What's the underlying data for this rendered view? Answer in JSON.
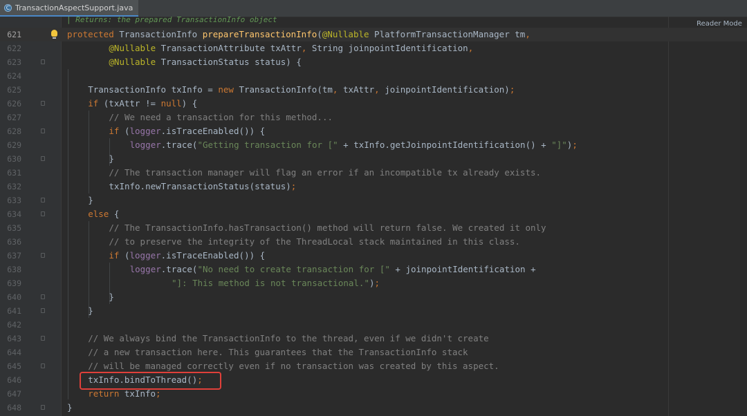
{
  "editor": {
    "tab": {
      "label": "TransactionAspectSupport.java",
      "icon": "java-class-icon"
    },
    "doc_fragment": "| Returns: the prepared TransactionInfo object",
    "reader_mode": "Reader Mode",
    "current_line": "621",
    "lines": [
      {
        "no": "621",
        "indent": 0,
        "fold": false,
        "bulb": true,
        "parts": [
          [
            "kw",
            "protected "
          ],
          [
            "",
            "TransactionInfo "
          ],
          [
            "fn",
            "prepareTransactionInfo"
          ],
          [
            "",
            "("
          ],
          [
            "an",
            "@Nullable"
          ],
          [
            "",
            " PlatformTransactionManager tm"
          ],
          [
            "kw",
            ","
          ]
        ]
      },
      {
        "no": "622",
        "indent": 2,
        "fold": false,
        "parts": [
          [
            "an",
            "@Nullable"
          ],
          [
            "",
            " TransactionAttribute txAttr"
          ],
          [
            "kw",
            ", "
          ],
          [
            "",
            "String joinpointIdentification"
          ],
          [
            "kw",
            ","
          ]
        ]
      },
      {
        "no": "623",
        "indent": 2,
        "fold": true,
        "parts": [
          [
            "an",
            "@Nullable"
          ],
          [
            "",
            " TransactionStatus status) {"
          ]
        ]
      },
      {
        "no": "624",
        "indent": 0,
        "fold": false,
        "parts": []
      },
      {
        "no": "625",
        "indent": 1,
        "fold": false,
        "parts": [
          [
            "",
            "TransactionInfo txInfo = "
          ],
          [
            "kw",
            "new "
          ],
          [
            "",
            "TransactionInfo(tm"
          ],
          [
            "kw",
            ", "
          ],
          [
            "",
            "txAttr"
          ],
          [
            "kw",
            ", "
          ],
          [
            "",
            "joinpointIdentification)"
          ],
          [
            "kw",
            ";"
          ]
        ]
      },
      {
        "no": "626",
        "indent": 1,
        "fold": true,
        "parts": [
          [
            "kw",
            "if "
          ],
          [
            "",
            "(txAttr != "
          ],
          [
            "kw",
            "null"
          ],
          [
            "",
            ") {"
          ]
        ]
      },
      {
        "no": "627",
        "indent": 2,
        "fold": false,
        "parts": [
          [
            "cm",
            "// We need a transaction for this method..."
          ]
        ]
      },
      {
        "no": "628",
        "indent": 2,
        "fold": true,
        "parts": [
          [
            "kw",
            "if "
          ],
          [
            "",
            "("
          ],
          [
            "fd",
            "logger"
          ],
          [
            "",
            ".isTraceEnabled()) {"
          ]
        ]
      },
      {
        "no": "629",
        "indent": 3,
        "fold": false,
        "parts": [
          [
            "fd",
            "logger"
          ],
          [
            "",
            ".trace("
          ],
          [
            "st",
            "\"Getting transaction for [\""
          ],
          [
            "",
            " + txInfo.getJoinpointIdentification() + "
          ],
          [
            "st",
            "\"]\""
          ],
          [
            "",
            ")"
          ],
          [
            "kw",
            ";"
          ]
        ]
      },
      {
        "no": "630",
        "indent": 2,
        "fold": true,
        "parts": [
          [
            "",
            "}"
          ]
        ]
      },
      {
        "no": "631",
        "indent": 2,
        "fold": false,
        "parts": [
          [
            "cm",
            "// The transaction manager will flag an error if an incompatible tx already exists."
          ]
        ]
      },
      {
        "no": "632",
        "indent": 2,
        "fold": false,
        "parts": [
          [
            "",
            "txInfo.newTransactionStatus(status)"
          ],
          [
            "kw",
            ";"
          ]
        ]
      },
      {
        "no": "633",
        "indent": 1,
        "fold": true,
        "parts": [
          [
            "",
            "}"
          ]
        ]
      },
      {
        "no": "634",
        "indent": 1,
        "fold": true,
        "parts": [
          [
            "kw",
            "else "
          ],
          [
            "",
            "{"
          ]
        ]
      },
      {
        "no": "635",
        "indent": 2,
        "fold": false,
        "parts": [
          [
            "cm",
            "// The TransactionInfo.hasTransaction() method will return false. We created it only"
          ]
        ]
      },
      {
        "no": "636",
        "indent": 2,
        "fold": false,
        "parts": [
          [
            "cm",
            "// to preserve the integrity of the ThreadLocal stack maintained in this class."
          ]
        ]
      },
      {
        "no": "637",
        "indent": 2,
        "fold": true,
        "parts": [
          [
            "kw",
            "if "
          ],
          [
            "",
            "("
          ],
          [
            "fd",
            "logger"
          ],
          [
            "",
            ".isTraceEnabled()) {"
          ]
        ]
      },
      {
        "no": "638",
        "indent": 3,
        "fold": false,
        "parts": [
          [
            "fd",
            "logger"
          ],
          [
            "",
            ".trace("
          ],
          [
            "st",
            "\"No need to create transaction for [\""
          ],
          [
            "",
            " + joinpointIdentification +"
          ]
        ]
      },
      {
        "no": "639",
        "indent": 5,
        "fold": false,
        "parts": [
          [
            "st",
            "\"]: This method is not transactional.\""
          ],
          [
            "",
            ")"
          ],
          [
            "kw",
            ";"
          ]
        ]
      },
      {
        "no": "640",
        "indent": 2,
        "fold": true,
        "parts": [
          [
            "",
            "}"
          ]
        ]
      },
      {
        "no": "641",
        "indent": 1,
        "fold": true,
        "parts": [
          [
            "",
            "}"
          ]
        ]
      },
      {
        "no": "642",
        "indent": 0,
        "fold": false,
        "parts": []
      },
      {
        "no": "643",
        "indent": 1,
        "fold": true,
        "parts": [
          [
            "cm",
            "// We always bind the TransactionInfo to the thread, even if we didn't create"
          ]
        ]
      },
      {
        "no": "644",
        "indent": 1,
        "fold": false,
        "parts": [
          [
            "cm",
            "// a new transaction here. This guarantees that the TransactionInfo stack"
          ]
        ]
      },
      {
        "no": "645",
        "indent": 1,
        "fold": true,
        "parts": [
          [
            "cm",
            "// will be managed correctly even if no transaction was created by this aspect."
          ]
        ]
      },
      {
        "no": "646",
        "indent": 1,
        "fold": false,
        "parts": [
          [
            "",
            "txInfo.bindToThread()"
          ],
          [
            "kw",
            ";"
          ]
        ]
      },
      {
        "no": "647",
        "indent": 1,
        "fold": false,
        "parts": [
          [
            "kw",
            "return "
          ],
          [
            "",
            "txInfo"
          ],
          [
            "kw",
            ";"
          ]
        ]
      },
      {
        "no": "648",
        "indent": 0,
        "fold": true,
        "parts": [
          [
            "",
            "}"
          ]
        ]
      }
    ]
  },
  "colors": {
    "background": "#2b2b2b",
    "keyword": "#cc7832",
    "method_declaration": "#ffc66d",
    "annotation": "#bbb529",
    "comment": "#808080",
    "string": "#6a8759",
    "field": "#9876aa",
    "highlight_box": "#e0403a"
  }
}
